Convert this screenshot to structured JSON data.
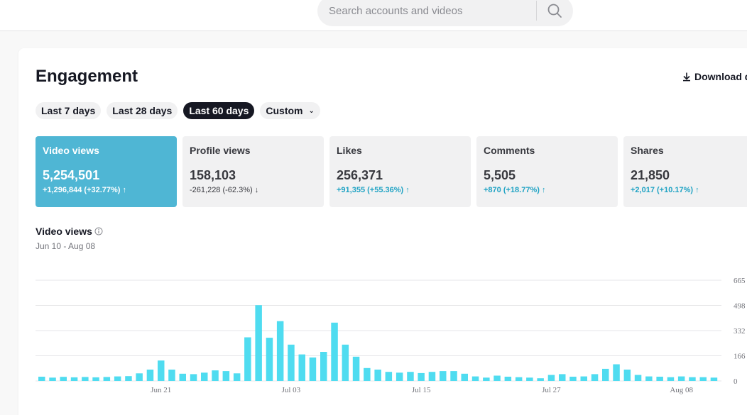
{
  "search": {
    "placeholder": "Search accounts and videos"
  },
  "header": {
    "title": "Engagement",
    "download_label": "Download d"
  },
  "date_ranges": [
    {
      "label": "Last 7 days",
      "active": false
    },
    {
      "label": "Last 28 days",
      "active": false
    },
    {
      "label": "Last 60 days",
      "active": true
    },
    {
      "label": "Custom",
      "active": false
    }
  ],
  "metrics": [
    {
      "label": "Video views",
      "value": "5,254,501",
      "change": "+1,296,844 (+32.77%) ↑",
      "selected": true
    },
    {
      "label": "Profile views",
      "value": "158,103",
      "change": "-261,228 (-62.3%) ↓"
    },
    {
      "label": "Likes",
      "value": "256,371",
      "change": "+91,355 (+55.36%) ↑"
    },
    {
      "label": "Comments",
      "value": "5,505",
      "change": "+870 (+18.77%) ↑"
    },
    {
      "label": "Shares",
      "value": "21,850",
      "change": "+2,017 (+10.17%) ↑"
    }
  ],
  "chart_section": {
    "title": "Video views",
    "date_range": "Jun 10 - Aug 08"
  },
  "colors": {
    "accent": "#4fb6d4",
    "bar": "#4fdcf0",
    "positive_change": "#20a3c4"
  },
  "chart_data": {
    "type": "bar",
    "title": "Video views",
    "x_start": "Jun 10",
    "x_end": "Aug 08",
    "x_tick_labels": [
      "Jun 21",
      "Jul 03",
      "Jul 15",
      "Jul 27",
      "Aug 08"
    ],
    "y_tick_labels": [
      "665",
      "498",
      "332",
      "166",
      "0"
    ],
    "grid": true,
    "values": [
      28,
      22,
      27,
      24,
      26,
      24,
      26,
      30,
      32,
      50,
      75,
      135,
      75,
      48,
      45,
      55,
      70,
      65,
      50,
      288,
      500,
      285,
      395,
      240,
      175,
      155,
      192,
      385,
      240,
      160,
      85,
      75,
      60,
      55,
      60,
      52,
      60,
      65,
      65,
      48,
      30,
      22,
      35,
      28,
      25,
      22,
      18,
      40,
      45,
      28,
      30,
      45,
      80,
      110,
      75,
      40,
      30,
      28,
      25,
      30,
      25,
      25,
      22
    ]
  }
}
